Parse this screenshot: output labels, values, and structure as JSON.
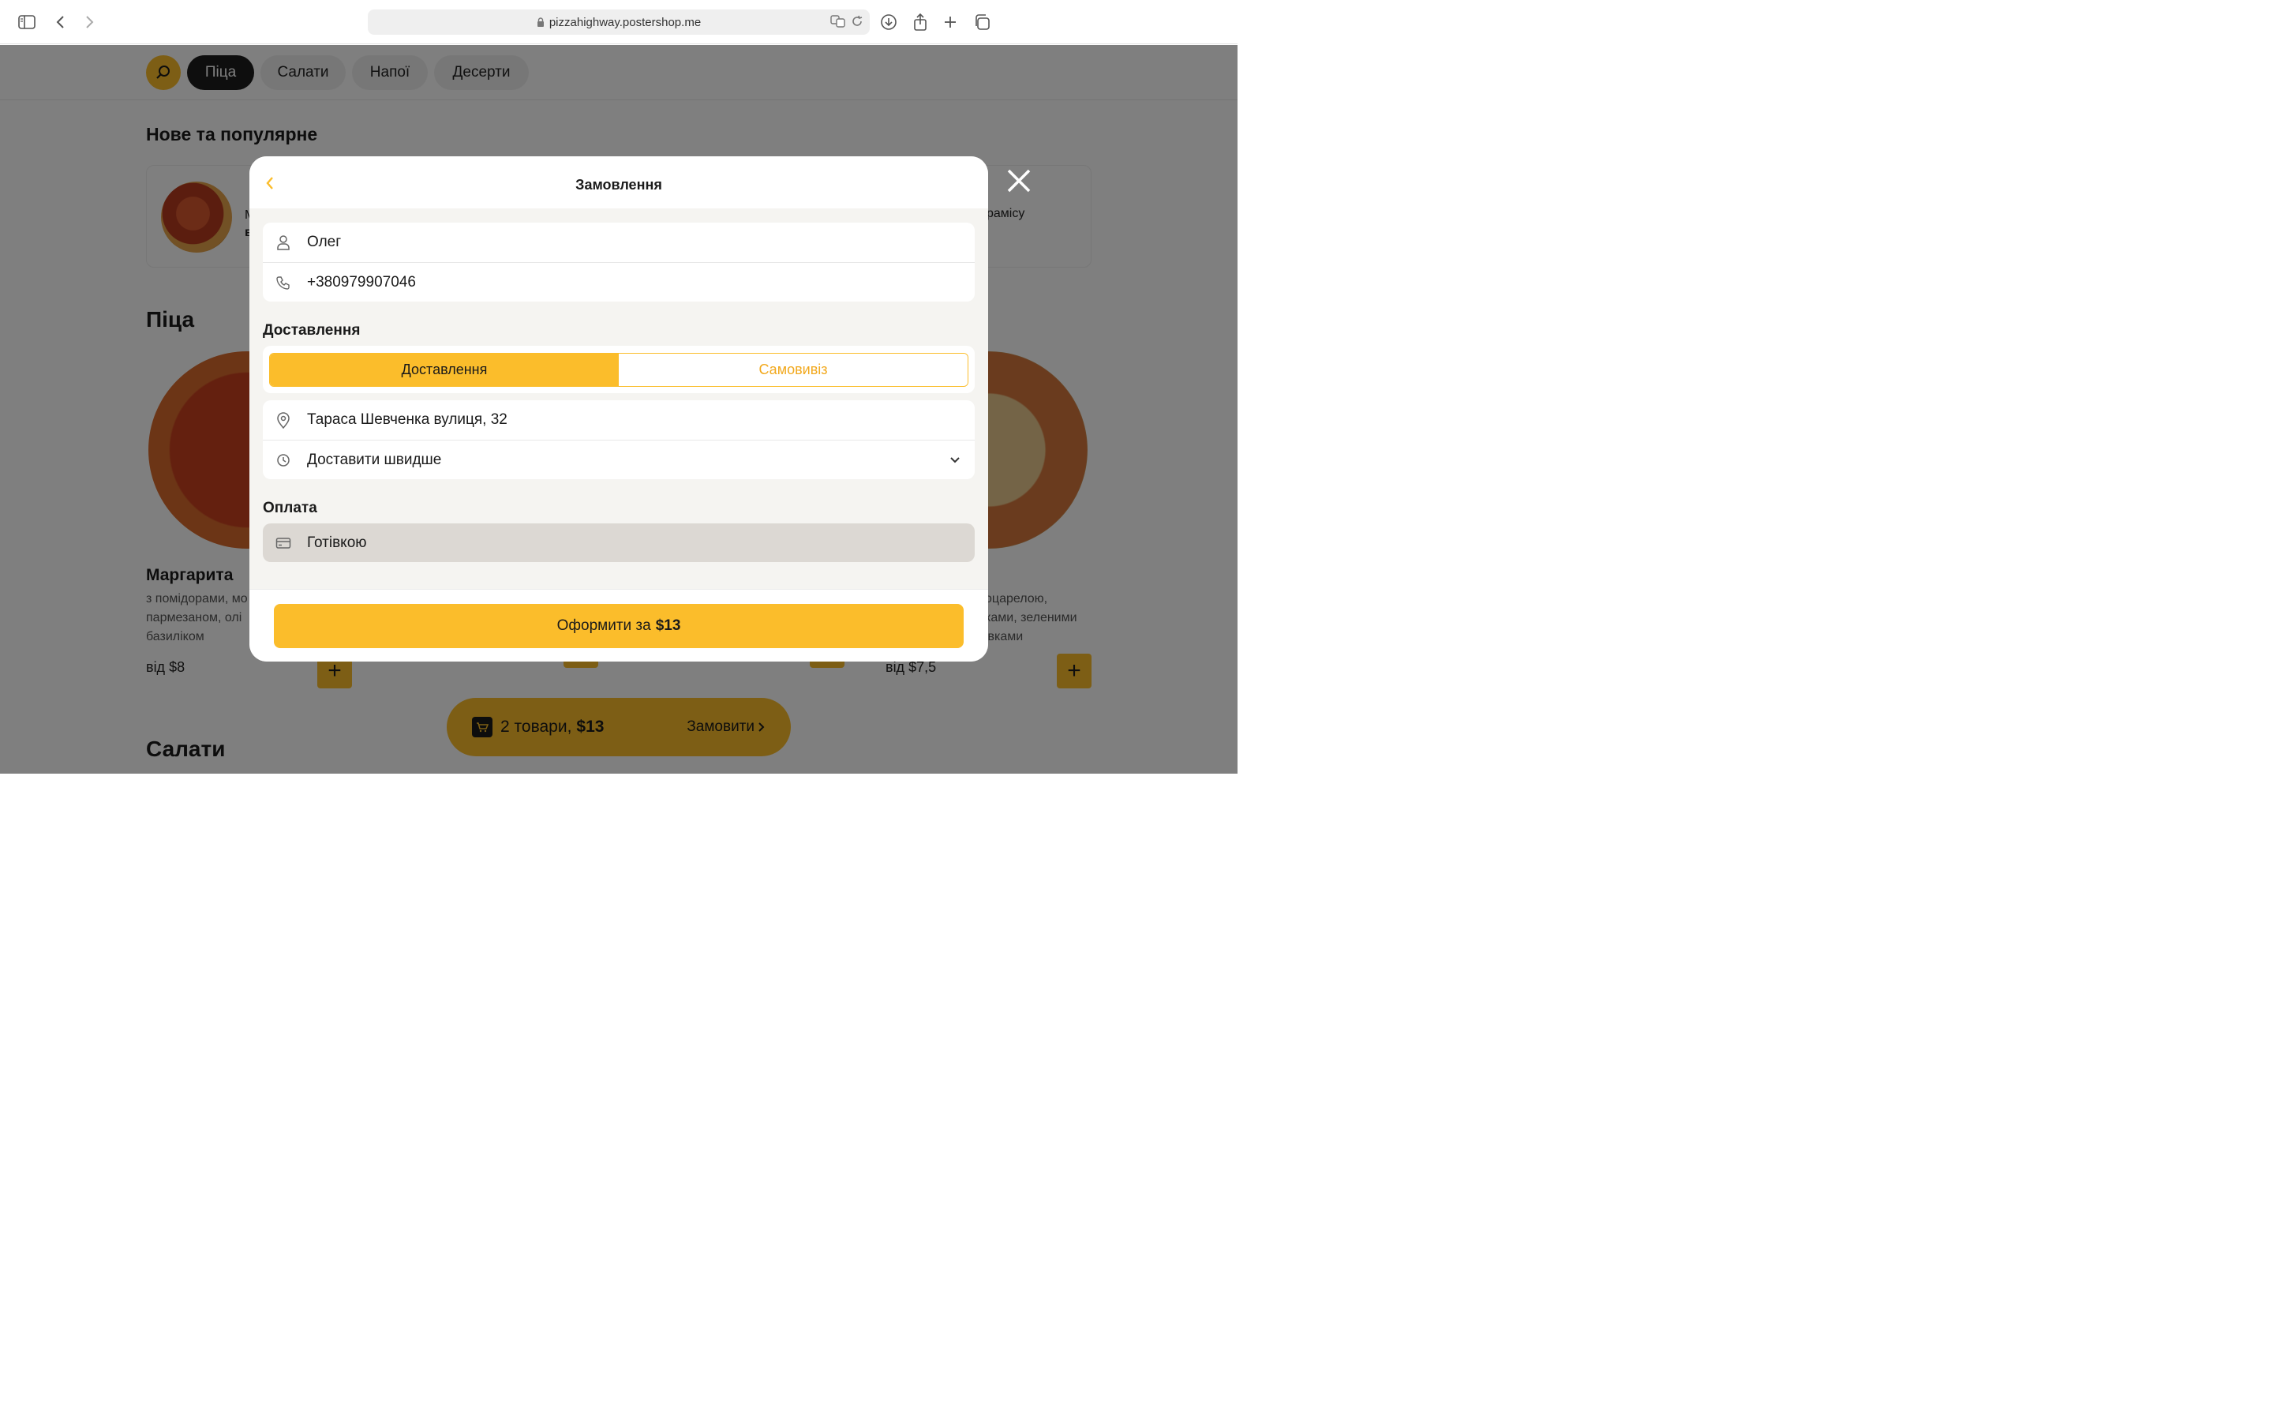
{
  "browser": {
    "url": "pizzahighway.postershop.me"
  },
  "nav": {
    "categories": [
      "Піца",
      "Салати",
      "Напої",
      "Десерти"
    ]
  },
  "page": {
    "popular_title": "Нове та популярне",
    "popular_left_text": "М",
    "popular_left_text2": "в",
    "popular_right_text": "рамісу",
    "pizza_title": "Піца",
    "product_left": {
      "name": "Маргарита",
      "desc": [
        "з помідорами, мо",
        "пармезаном, олі",
        "базиліком"
      ],
      "price": "від $8"
    },
    "product_right": {
      "desc": [
        "оцарелою,",
        "ками, зеленими",
        "івками"
      ],
      "price": "від $7,5"
    },
    "salads_title": "Салати"
  },
  "cart": {
    "count_text": "2 товари,",
    "total": "$13",
    "order_label": "Замовити"
  },
  "modal": {
    "title": "Замовлення",
    "name_value": "Олег",
    "phone_value": "+380979907046",
    "delivery_section": "Доставлення",
    "delivery_option": "Доставлення",
    "pickup_option": "Самовивіз",
    "address_value": "Тараса Шевченка вулиця, 32",
    "time_value": "Доставити швидше",
    "payment_section": "Оплата",
    "payment_value": "Готівкою",
    "submit_prefix": "Оформити за",
    "submit_amount": "$13"
  },
  "colors": {
    "accent": "#fbbd2b",
    "accent_text": "#f2a91e",
    "dark": "#1c1c1c"
  }
}
